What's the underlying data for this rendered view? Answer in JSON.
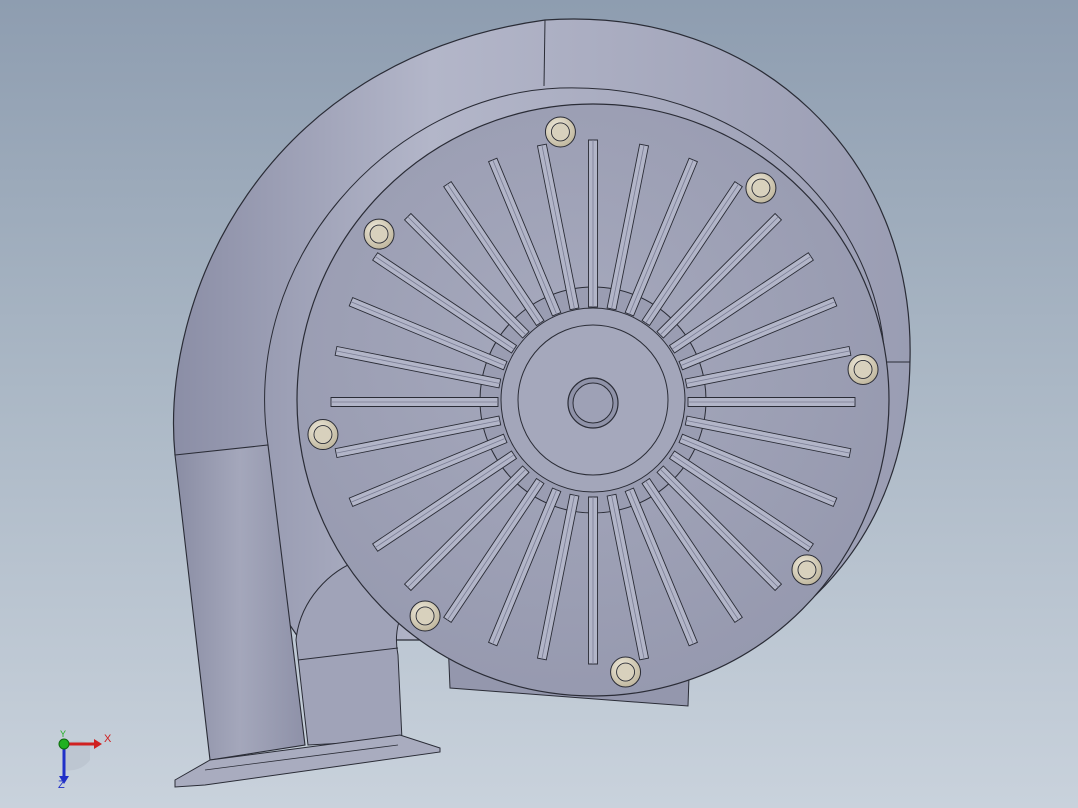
{
  "viewport": {
    "background_top": "#8e9db0",
    "background_bottom": "#c9d2dc"
  },
  "model": {
    "body_color": "#9ea0b6",
    "body_highlight": "#b9bccd",
    "body_shadow": "#7c7f96",
    "bolt_color": "#d8d1bd",
    "outline_color": "#2a2c36",
    "fin_count": 32,
    "bolt_count": 8
  },
  "triad": {
    "x_label": "X",
    "y_label": "Y",
    "z_label": "Z",
    "x_color": "#d02020",
    "y_color": "#20b020",
    "z_color": "#2030c8"
  }
}
